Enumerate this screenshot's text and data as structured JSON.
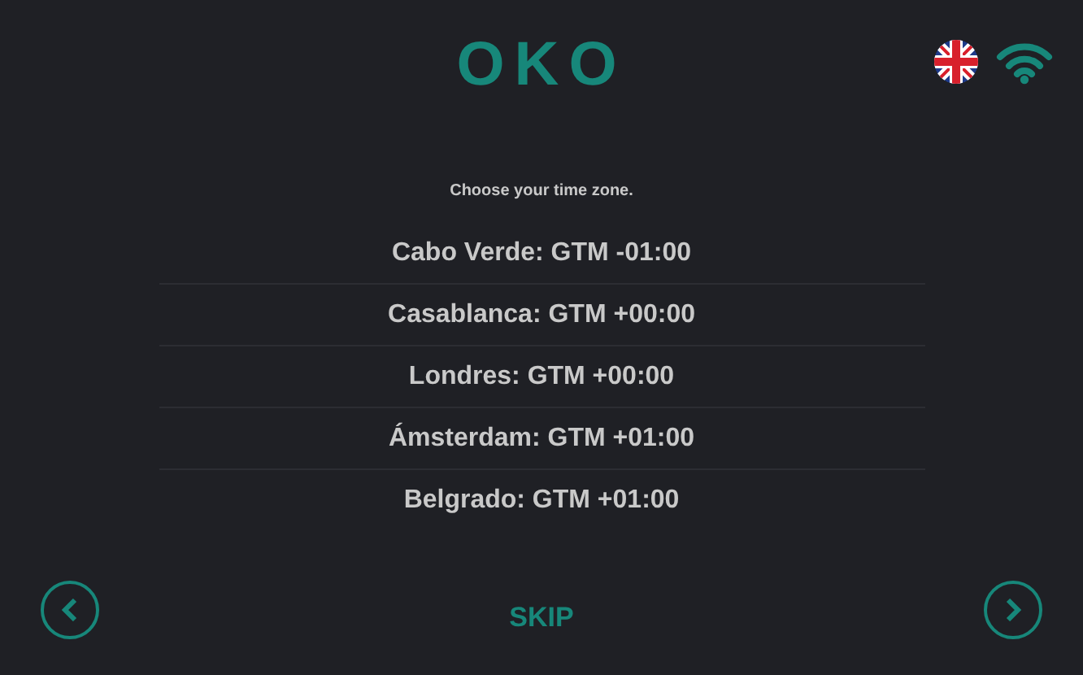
{
  "logo": "OKO",
  "prompt": "Choose your time zone.",
  "time_zones": [
    {
      "label": "Cabo Verde: GTM -01:00"
    },
    {
      "label": "Casablanca: GTM +00:00"
    },
    {
      "label": "Londres: GTM +00:00"
    },
    {
      "label": "Ámsterdam: GTM +01:00"
    },
    {
      "label": "Belgrado: GTM +01:00"
    }
  ],
  "skip_button": "SKIP"
}
